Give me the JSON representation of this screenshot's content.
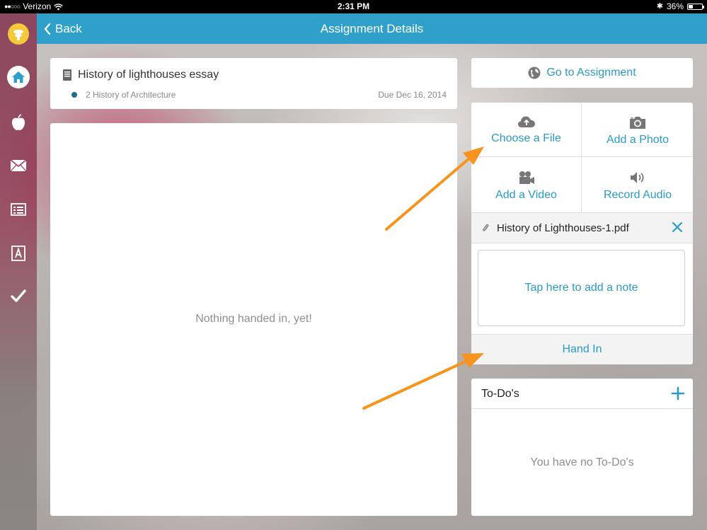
{
  "status_bar": {
    "carrier": "Verizon",
    "time": "2:31 PM",
    "battery": "36%",
    "battery_level": 0.36
  },
  "nav": {
    "back_label": "Back",
    "title": "Assignment Details"
  },
  "sidebar": {
    "items": [
      {
        "icon": "logo-icon"
      },
      {
        "icon": "home-icon"
      },
      {
        "icon": "apple-icon"
      },
      {
        "icon": "mail-icon"
      },
      {
        "icon": "list-icon"
      },
      {
        "icon": "gradebook-icon"
      },
      {
        "icon": "checkmark-icon"
      }
    ]
  },
  "assignment": {
    "title": "History of lighthouses essay",
    "course": "2 History of Architecture",
    "due": "Due Dec 16, 2014"
  },
  "submission": {
    "empty_text": "Nothing handed in, yet!"
  },
  "actions": {
    "go_to_assignment": "Go to Assignment",
    "choose_file": "Choose a File",
    "add_photo": "Add a Photo",
    "add_video": "Add a Video",
    "record_audio": "Record Audio"
  },
  "attachment": {
    "file_name": "History of Lighthouses-1.pdf"
  },
  "note": {
    "placeholder": "Tap here to add a note"
  },
  "hand_in": {
    "label": "Hand In"
  },
  "todos": {
    "title": "To-Do's",
    "empty_text": "You have no To-Do's"
  },
  "colors": {
    "accent": "#2ea0c9",
    "link": "#2a9ac8",
    "annotation_arrow": "#f7941d",
    "course_dot": "#1f6d82"
  }
}
